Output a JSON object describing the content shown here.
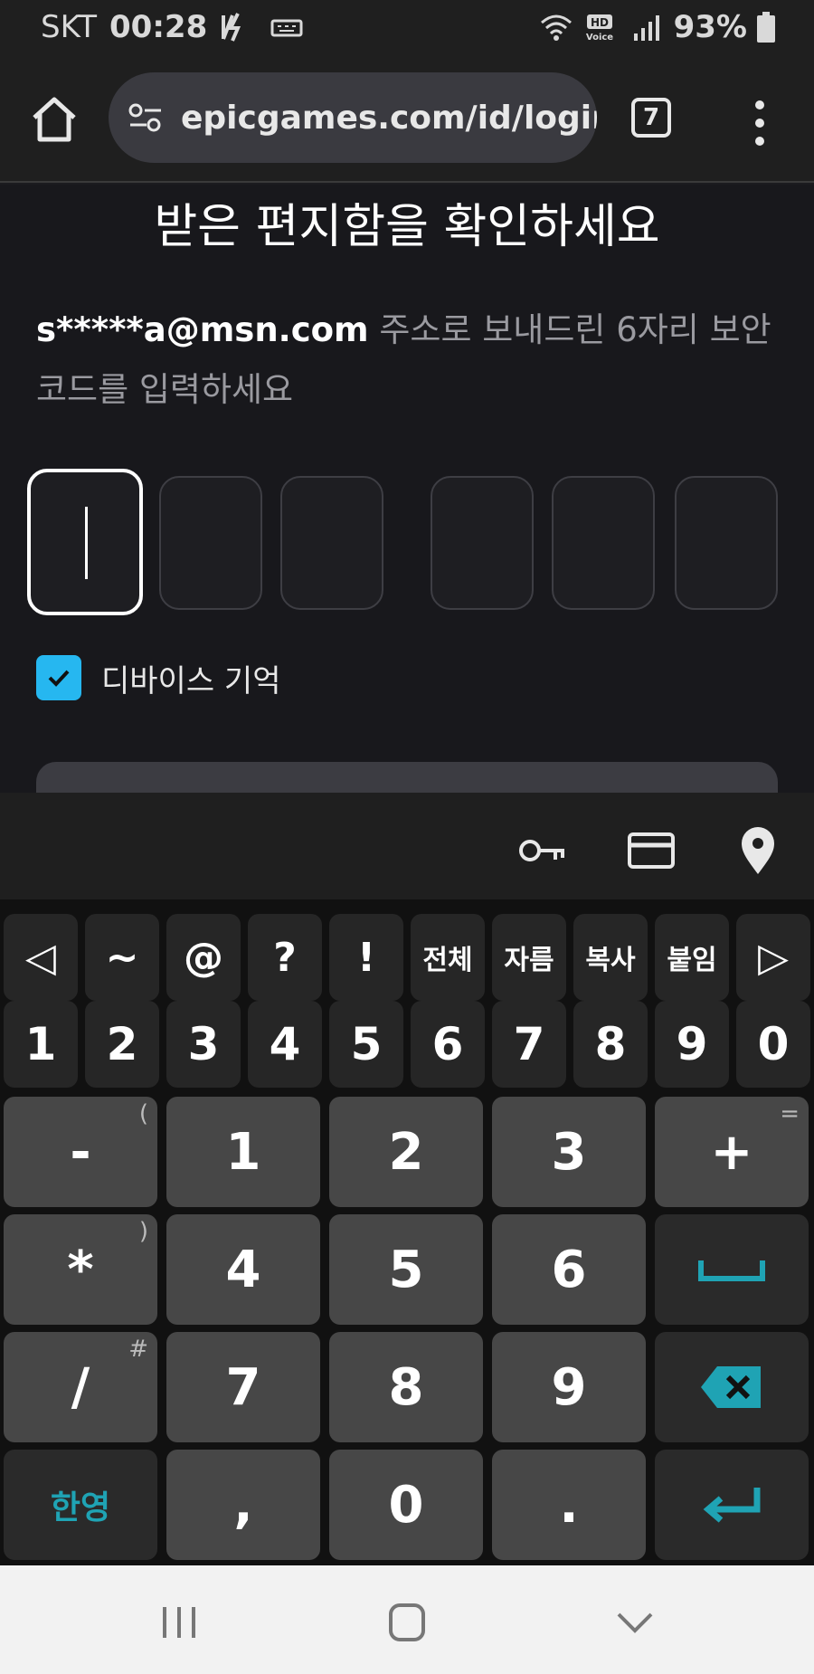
{
  "status": {
    "carrier": "SKT",
    "time": "00:28",
    "battery": "93%"
  },
  "browser": {
    "url": "epicgames.com/id/login",
    "tab_count": "7"
  },
  "page": {
    "title": "받은 편지함을 확인하세요",
    "email": "s*****a@msn.com",
    "instruction": " 주소로 보내드린 6자리 보안 코드를 입력하세요",
    "code_digits": [
      "",
      "",
      "",
      "",
      "",
      ""
    ],
    "remember_label": "디바이스 기억",
    "remember_checked": true
  },
  "keyboard": {
    "row1": [
      "◁",
      "~",
      "@",
      "?",
      "!",
      "전체",
      "자름",
      "복사",
      "붙임",
      "▷"
    ],
    "row2": [
      "1",
      "2",
      "3",
      "4",
      "5",
      "6",
      "7",
      "8",
      "9",
      "0"
    ],
    "numpad": [
      [
        {
          "label": "-",
          "sup": "("
        },
        {
          "label": "1"
        },
        {
          "label": "2"
        },
        {
          "label": "3"
        },
        {
          "label": "+",
          "sup": "="
        }
      ],
      [
        {
          "label": "*",
          "sup": ")"
        },
        {
          "label": "4"
        },
        {
          "label": "5"
        },
        {
          "label": "6"
        },
        {
          "label": "space"
        }
      ],
      [
        {
          "label": "/",
          "sup": "#"
        },
        {
          "label": "7"
        },
        {
          "label": "8"
        },
        {
          "label": "9"
        },
        {
          "label": "backspace"
        }
      ],
      [
        {
          "label": "한영"
        },
        {
          "label": ","
        },
        {
          "label": "0"
        },
        {
          "label": "."
        },
        {
          "label": "enter"
        }
      ]
    ]
  },
  "accent": "#1fa3b4",
  "checkbox_color": "#26b7f0"
}
